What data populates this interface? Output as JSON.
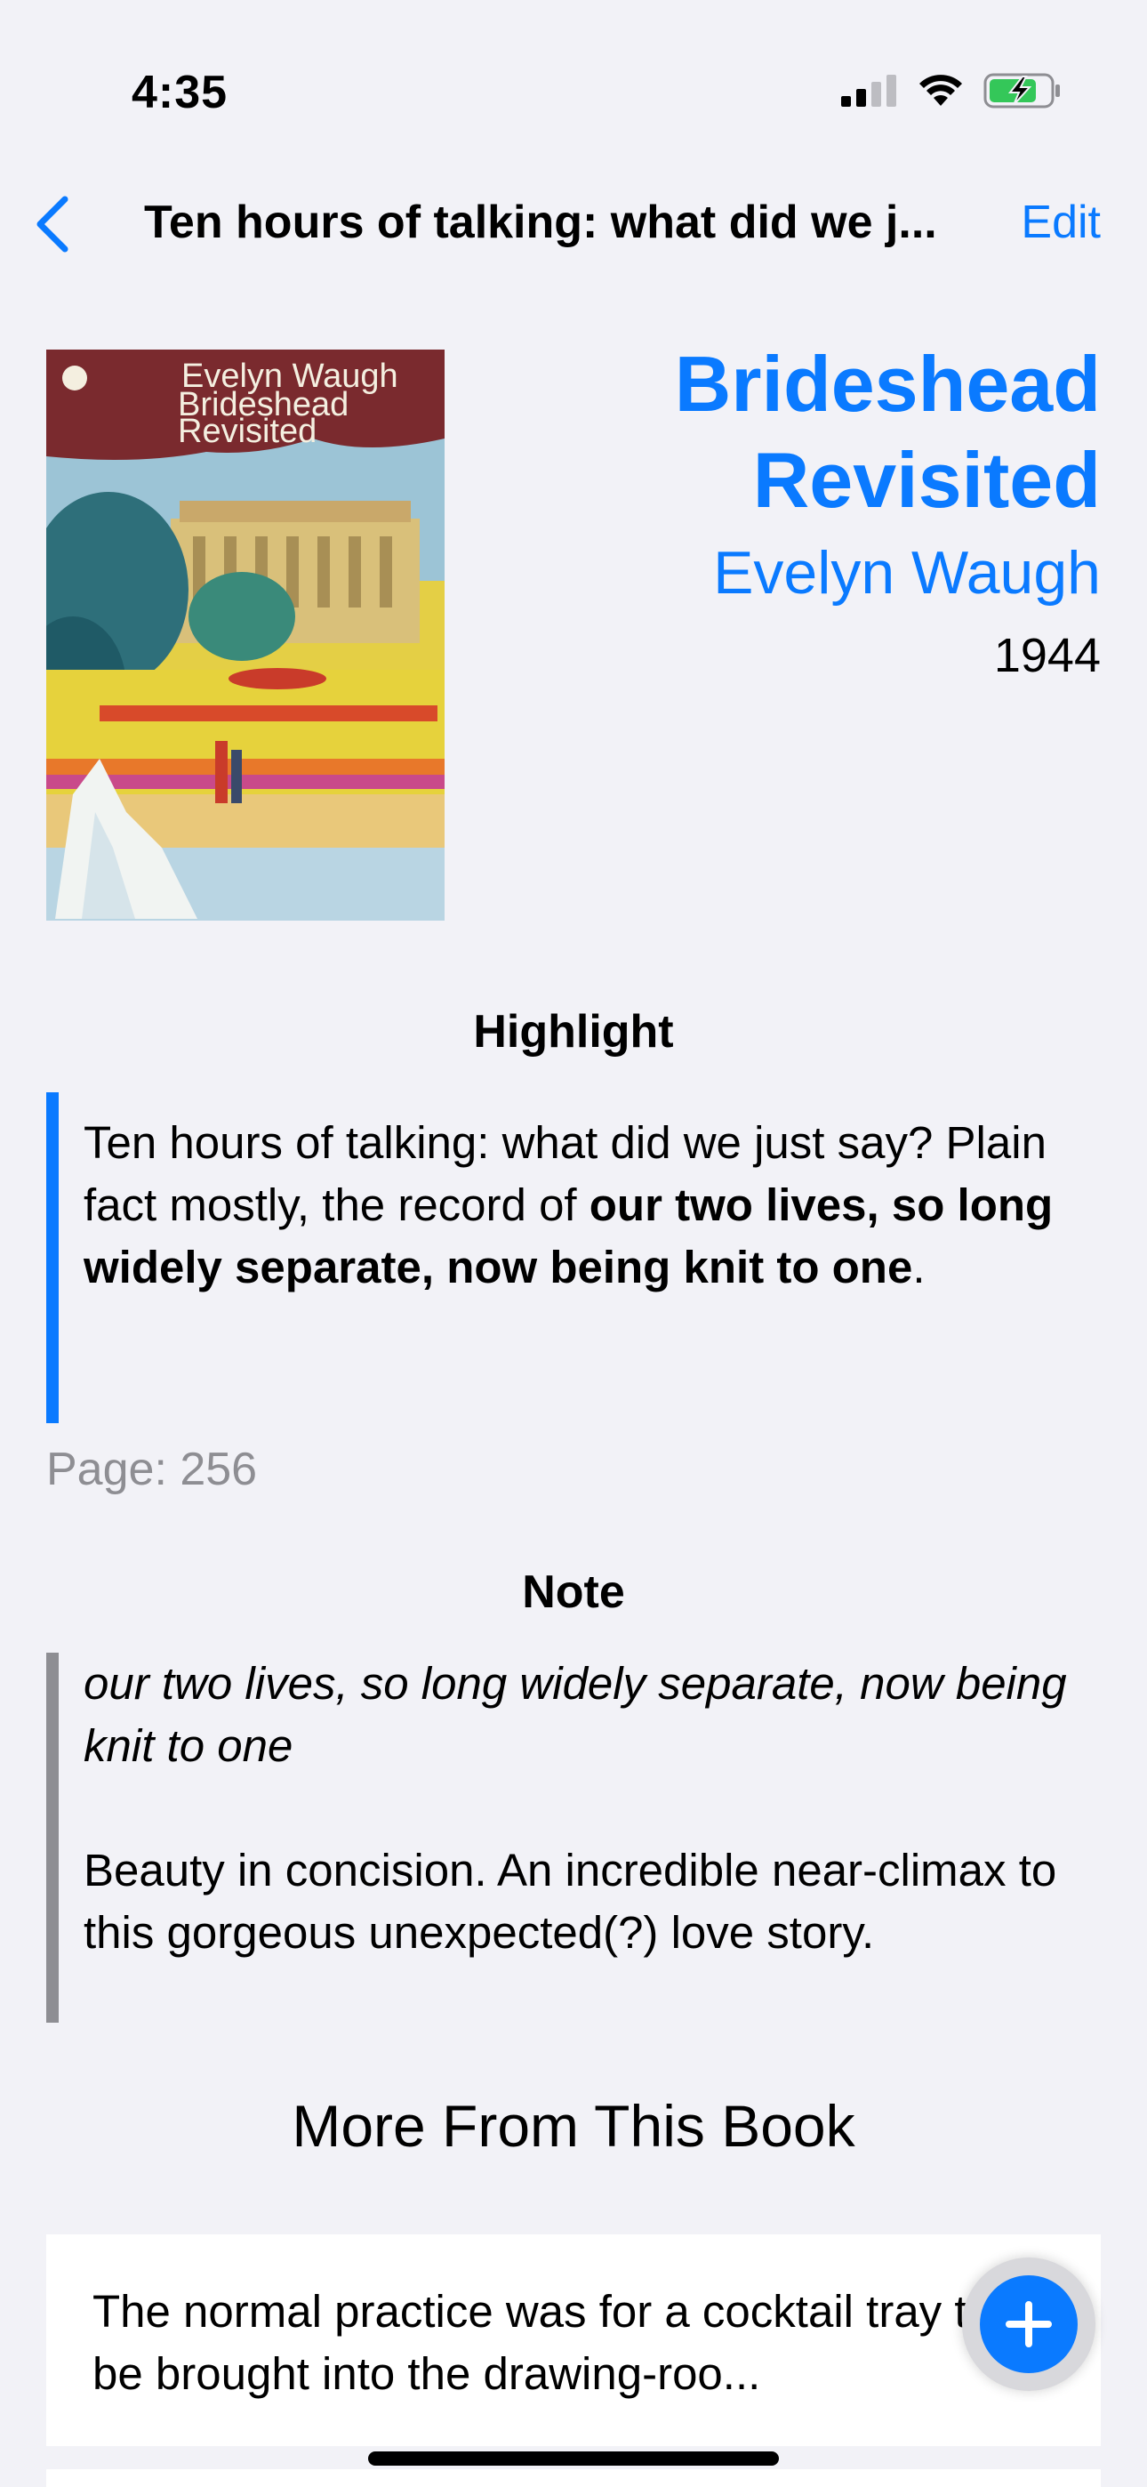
{
  "status_bar": {
    "time": "4:35",
    "icons": [
      "signal-icon",
      "wifi-icon",
      "battery-charging-icon"
    ]
  },
  "nav": {
    "back_icon": "chevron-left-icon",
    "title": "Ten hours of talking: what did we j...",
    "edit_label": "Edit"
  },
  "book": {
    "cover_author": "Evelyn Waugh",
    "cover_title_line1": "Brideshead",
    "cover_title_line2": "Revisited",
    "title": "Brideshead Revisited",
    "author": "Evelyn Waugh",
    "year": "1944"
  },
  "highlight": {
    "heading": "Highlight",
    "text_plain": "Ten hours of talking: what did we just say? Plain fact mostly, the record of ",
    "text_bold": "our two lives, so long widely separate, now being knit to one",
    "text_end": ".",
    "page_label": "Page: 256"
  },
  "note": {
    "heading": "Note",
    "italic_text": "our two lives, so long widely separate, now being knit to one",
    "body_text": "Beauty in concision. An incredible near-climax to this gorgeous unexpected(?) love story."
  },
  "more": {
    "heading": "More From This Book",
    "card_text": "The normal practice was for a cocktail tray to be brought into the drawing-roo..."
  },
  "colors": {
    "accent": "#0a7aff",
    "highlight_bar": "#0a7aff",
    "note_bar": "#8e8e93",
    "background": "#f2f2f7"
  }
}
